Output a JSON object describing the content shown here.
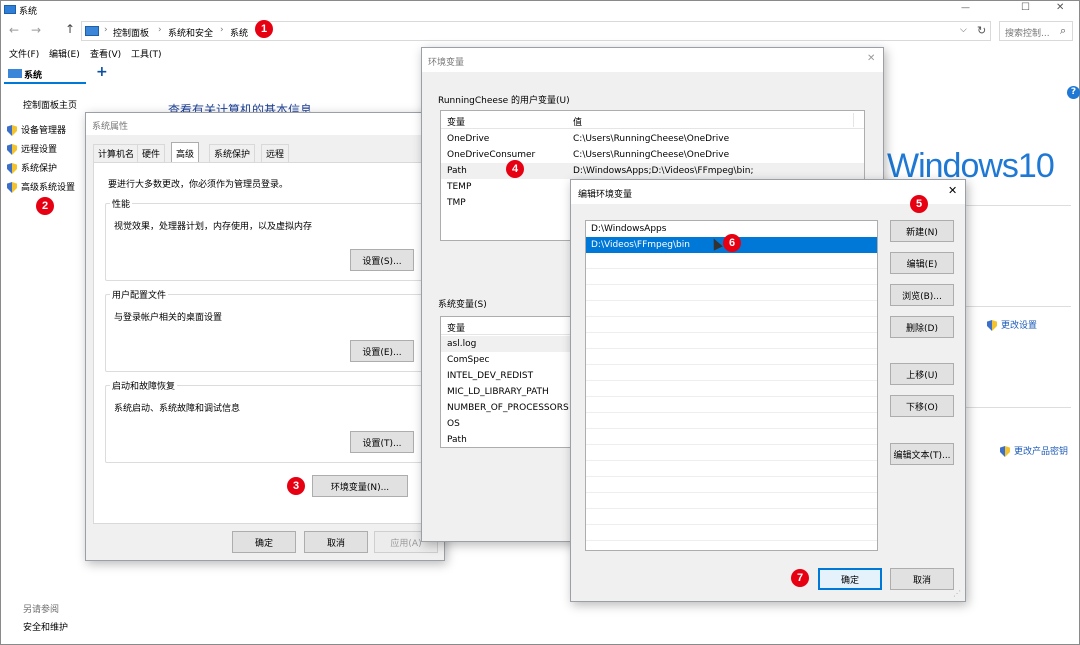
{
  "app": {
    "title": "系统",
    "tab_label": "系统"
  },
  "titlebar": {
    "minimize": "—",
    "maximize": "☐",
    "close": "✕"
  },
  "address": {
    "back": "←",
    "forward": "→",
    "up": "↑",
    "crumbs": [
      "控制面板",
      "系统和安全",
      "系统"
    ],
    "search_placeholder": "搜索控制...",
    "refresh": "↻",
    "dropdown": "⌵",
    "search_icon": "⌕"
  },
  "menubar": {
    "items": [
      "文件(F)",
      "编辑(E)",
      "查看(V)",
      "工具(T)"
    ]
  },
  "tabbar": {
    "add": "+"
  },
  "help": "?",
  "sidebar": {
    "home": "控制面板主页",
    "items": [
      "设备管理器",
      "远程设置",
      "系统保护",
      "高级系统设置"
    ],
    "see_also": "另请参阅",
    "see_also_items": [
      "安全和维护"
    ]
  },
  "main": {
    "heading": "查看有关计算机的基本信息",
    "windows_logo": "Windows10",
    "change_settings": "更改设置",
    "change_key": "更改产品密钥"
  },
  "sysprops": {
    "title": "系统属性",
    "tabs": [
      "计算机名",
      "硬件",
      "高级",
      "系统保护",
      "远程"
    ],
    "admin_note": "要进行大多数更改，你必须作为管理员登录。",
    "perf": {
      "label": "性能",
      "desc": "视觉效果，处理器计划，内存使用，以及虚拟内存",
      "btn": "设置(S)..."
    },
    "profile": {
      "label": "用户配置文件",
      "desc": "与登录帐户相关的桌面设置",
      "btn": "设置(E)..."
    },
    "startup": {
      "label": "启动和故障恢复",
      "desc": "系统启动、系统故障和调试信息",
      "btn": "设置(T)..."
    },
    "env_btn": "环境变量(N)...",
    "ok": "确定",
    "cancel": "取消",
    "apply": "应用(A)"
  },
  "envvars": {
    "title": "环境变量",
    "user_label": "RunningCheese 的用户变量(U)",
    "col_var": "变量",
    "col_val": "值",
    "user_rows": [
      {
        "name": "OneDrive",
        "value": "C:\\Users\\RunningCheese\\OneDrive"
      },
      {
        "name": "OneDriveConsumer",
        "value": "C:\\Users\\RunningCheese\\OneDrive"
      },
      {
        "name": "Path",
        "value": "D:\\WindowsApps;D:\\Videos\\FFmpeg\\bin;"
      },
      {
        "name": "TEMP",
        "value": ""
      },
      {
        "name": "TMP",
        "value": ""
      }
    ],
    "sys_label": "系统变量(S)",
    "sys_rows": [
      "asl.log",
      "ComSpec",
      "INTEL_DEV_REDIST",
      "MIC_LD_LIBRARY_PATH",
      "NUMBER_OF_PROCESSORS",
      "OS",
      "Path"
    ]
  },
  "editenv": {
    "title": "编辑环境变量",
    "close": "✕",
    "entries": [
      "D:\\WindowsApps",
      "D:\\Videos\\FFmpeg\\bin"
    ],
    "buttons": {
      "new": "新建(N)",
      "edit": "编辑(E)",
      "browse": "浏览(B)...",
      "delete": "删除(D)",
      "up": "上移(U)",
      "down": "下移(O)",
      "edit_text": "编辑文本(T)..."
    },
    "ok": "确定",
    "cancel": "取消"
  },
  "badges": [
    "1",
    "2",
    "3",
    "4",
    "5",
    "6",
    "7"
  ],
  "colors": {
    "accent": "#0078d7",
    "badge": "#e60012",
    "link": "#1c5bb8"
  }
}
